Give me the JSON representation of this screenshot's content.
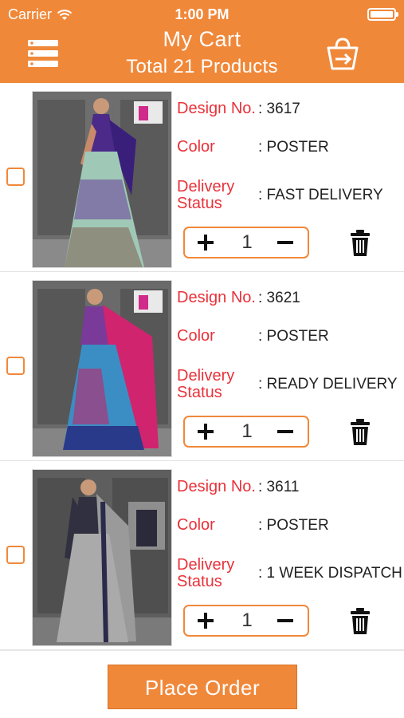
{
  "status_bar": {
    "carrier": "Carrier",
    "time": "1:00 PM"
  },
  "header": {
    "title": "My Cart",
    "subtitle": "Total 21 Products",
    "menu_icon": "list-menu-icon",
    "cart_icon": "basket-arrow-icon"
  },
  "labels": {
    "design_no": "Design No.",
    "color": "Color",
    "delivery_line1": "Delivery",
    "delivery_line2": "Status"
  },
  "items": [
    {
      "design_no": ": 3617",
      "color": ": POSTER",
      "delivery_status": ": FAST DELIVERY",
      "quantity": "1",
      "checked": false
    },
    {
      "design_no": ": 3621",
      "color": ": POSTER",
      "delivery_status": ": READY DELIVERY",
      "quantity": "1",
      "checked": false
    },
    {
      "design_no": ": 3611",
      "color": ": POSTER",
      "delivery_status": ": 1 WEEK DISPATCH",
      "quantity": "1",
      "checked": false
    }
  ],
  "footer": {
    "place_order_label": "Place Order"
  },
  "colors": {
    "accent": "#F0883A",
    "label_red": "#E8323A",
    "text_dark": "#222222"
  }
}
